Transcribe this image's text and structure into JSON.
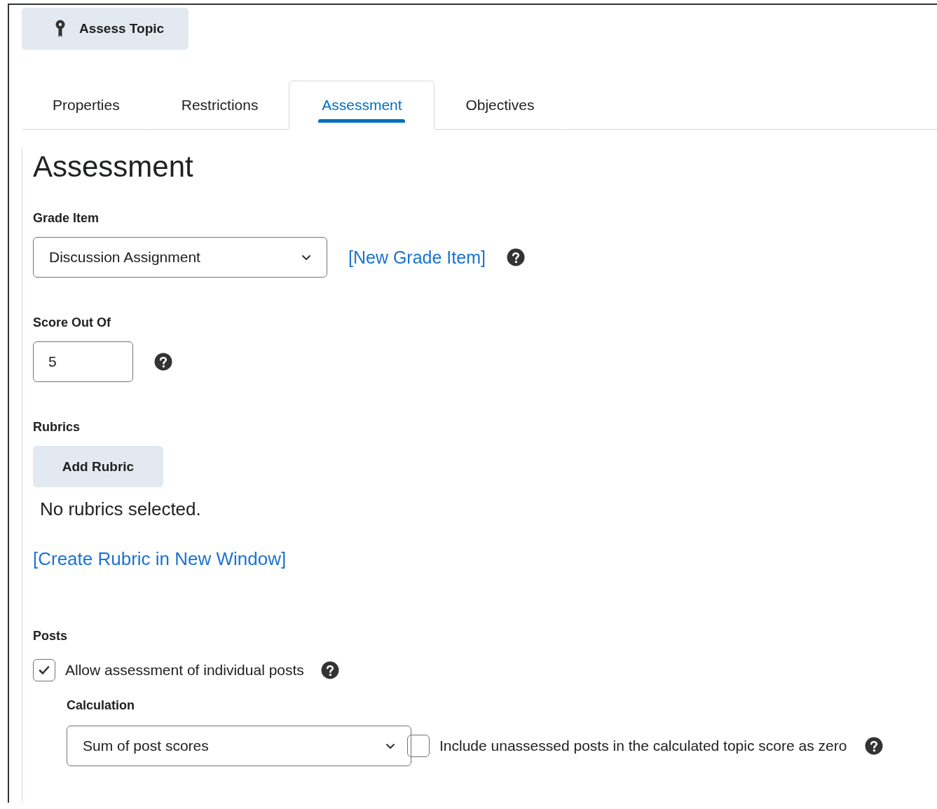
{
  "assess_button": {
    "label": "Assess Topic"
  },
  "tabs": [
    {
      "label": "Properties",
      "selected": false
    },
    {
      "label": "Restrictions",
      "selected": false
    },
    {
      "label": "Assessment",
      "selected": true
    },
    {
      "label": "Objectives",
      "selected": false
    }
  ],
  "heading": "Assessment",
  "grade_item": {
    "label": "Grade Item",
    "value": "Discussion Assignment",
    "link": "[New Grade Item]"
  },
  "score_out_of": {
    "label": "Score Out Of",
    "value": "5"
  },
  "rubrics": {
    "label": "Rubrics",
    "button": "Add Rubric",
    "message": "No rubrics selected.",
    "link": "[Create Rubric in New Window]"
  },
  "posts": {
    "label": "Posts",
    "allow": {
      "label": "Allow assessment of individual posts",
      "checked": true
    },
    "calculation": {
      "label": "Calculation",
      "value": "Sum of post scores"
    },
    "include_unassessed": {
      "label": "Include unassessed posts in the calculated topic score as zero",
      "checked": false
    }
  }
}
